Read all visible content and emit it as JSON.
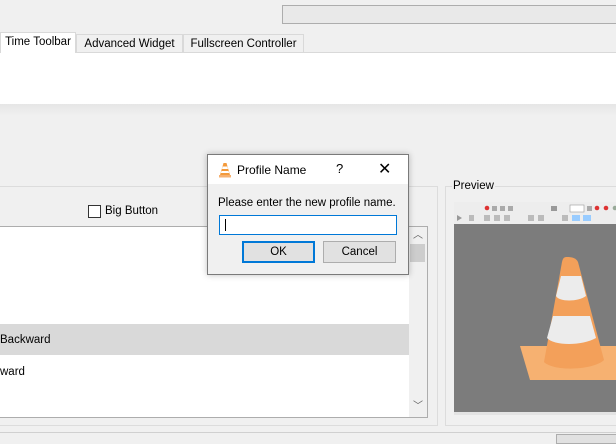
{
  "tabs": [
    {
      "label": "Time Toolbar",
      "active": true
    },
    {
      "label": "Advanced Widget",
      "active": false
    },
    {
      "label": "Fullscreen Controller",
      "active": false
    }
  ],
  "options": {
    "big_button_label": "Big Button",
    "big_button_checked": false
  },
  "list": {
    "items": [
      "Backward",
      "ward"
    ],
    "selected_index": 0
  },
  "preview": {
    "label": "Preview",
    "icon": "vlc-cone"
  },
  "dialog": {
    "icon": "vlc-cone-icon",
    "title": "Profile Name",
    "help_label": "?",
    "close_label": "✕",
    "prompt": "Please enter the new profile name.",
    "input_value": "",
    "ok_label": "OK",
    "cancel_label": "Cancel"
  },
  "colors": {
    "accent": "#0078d7",
    "cone_orange": "#f4a25b",
    "preview_bg": "#7c7c7c"
  }
}
